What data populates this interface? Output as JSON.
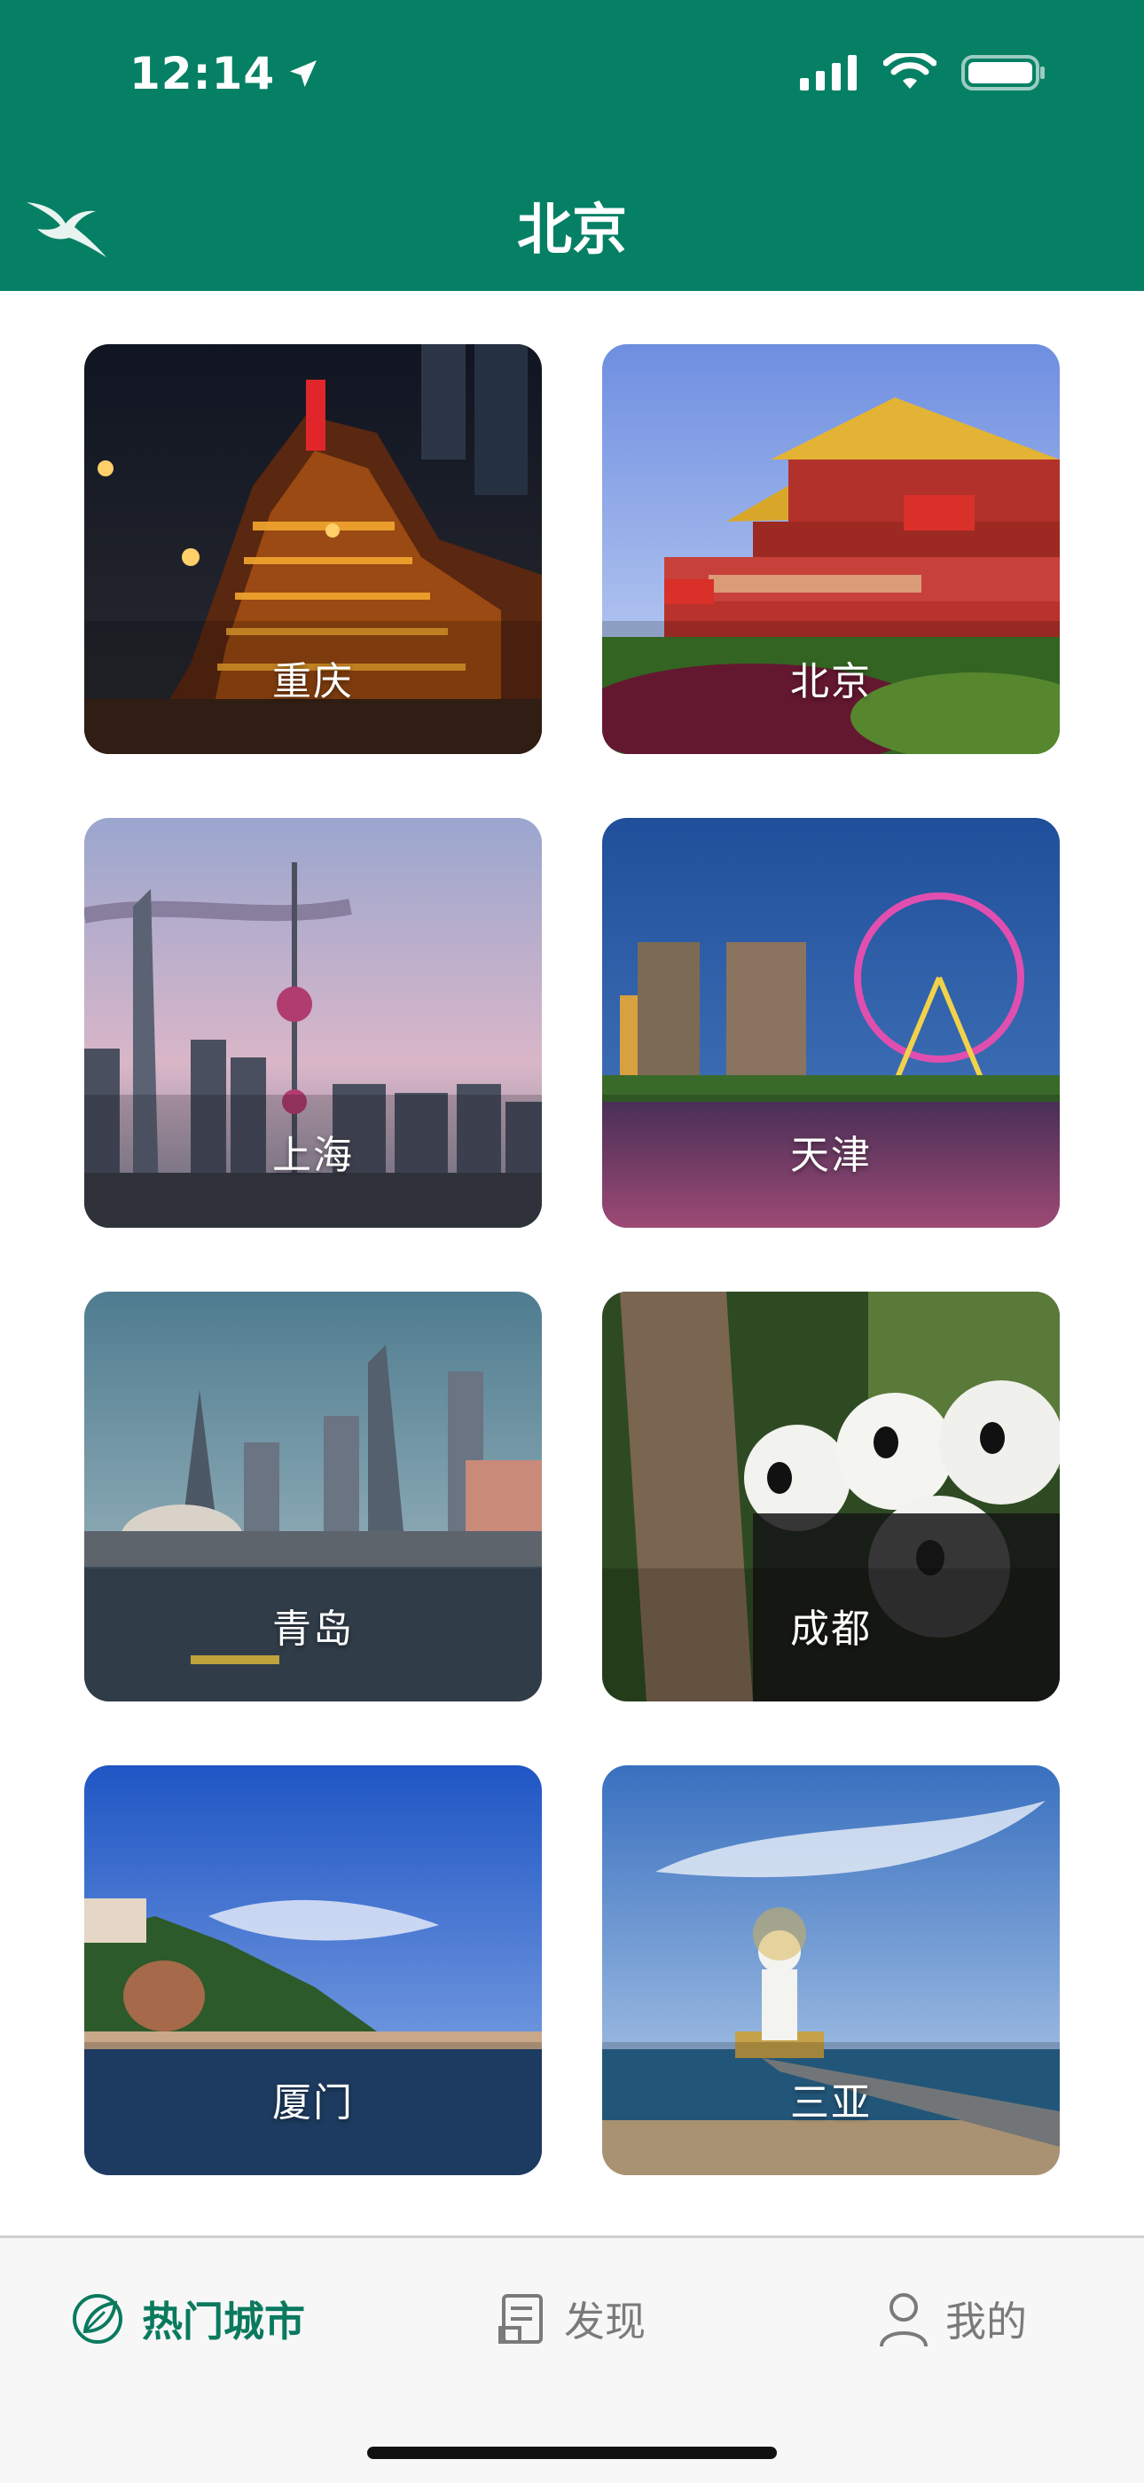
{
  "status_bar": {
    "time": "12:14"
  },
  "header": {
    "title": "北京"
  },
  "cities": [
    {
      "name": "重庆"
    },
    {
      "name": "北京"
    },
    {
      "name": "上海"
    },
    {
      "name": "天津"
    },
    {
      "name": "青岛"
    },
    {
      "name": "成都"
    },
    {
      "name": "厦门"
    },
    {
      "name": "三亚"
    }
  ],
  "tabs": [
    {
      "label": "热门城市",
      "icon": "leaf-globe-icon",
      "active": true
    },
    {
      "label": "发现",
      "icon": "document-icon",
      "active": false
    },
    {
      "label": "我的",
      "icon": "user-icon",
      "active": false
    }
  ],
  "colors": {
    "header_bg": "#068064",
    "active_tab": "#0a7a5f",
    "inactive_tab": "#7a7a7a"
  }
}
